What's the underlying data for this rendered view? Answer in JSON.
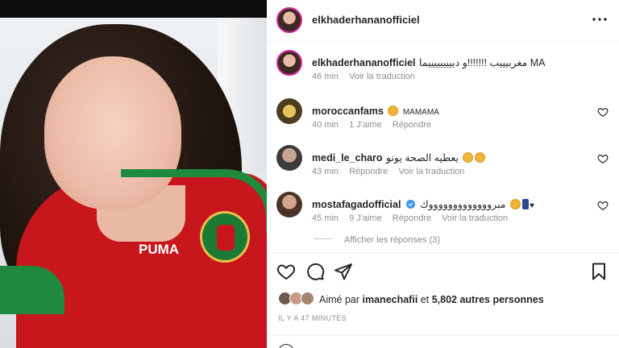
{
  "post": {
    "username": "elkhaderhananofficiel",
    "photo_brand": "PUMA"
  },
  "caption": {
    "author": "elkhaderhananofficiel",
    "text": "مغربيييب !!!!!!!و ديييييييييما MA",
    "time": "46 min",
    "translate": "Voir la traduction"
  },
  "comments": [
    {
      "author": "moroccanfams",
      "text": "MAMAMA",
      "time": "40 min",
      "likes": "1 J'aime",
      "reply": "Répondre",
      "translate": ""
    },
    {
      "author": "medi_le_charo",
      "text": "يعطيه الصحة يونو",
      "time": "43 min",
      "likes": "",
      "reply": "Répondre",
      "translate": "Voir la traduction"
    },
    {
      "author": "mostafagadofficial",
      "text": "مبروووووووووووووك",
      "time": "45 min",
      "likes": "9 J'aime",
      "reply": "Répondre",
      "translate": "Voir la traduction"
    }
  ],
  "view_replies": "Afficher les réponses (3)",
  "likes": {
    "prefix": "Aimé par",
    "user": "imanechafii",
    "connector": "et",
    "others": "5,802 autres personnes"
  },
  "timestamp": "IL Y A 47 MINUTES",
  "icons": {
    "more": "more-horizontal-icon",
    "heart": "heart-icon",
    "comment": "comment-bubble-icon",
    "share": "paper-plane-icon",
    "save": "bookmark-icon",
    "emoji": "smiley-icon"
  },
  "colors": {
    "text": "#262626",
    "secondary": "#8e8e8e",
    "verified": "#3897f0",
    "jersey_red": "#c8161d",
    "jersey_green": "#1f8a3d"
  }
}
